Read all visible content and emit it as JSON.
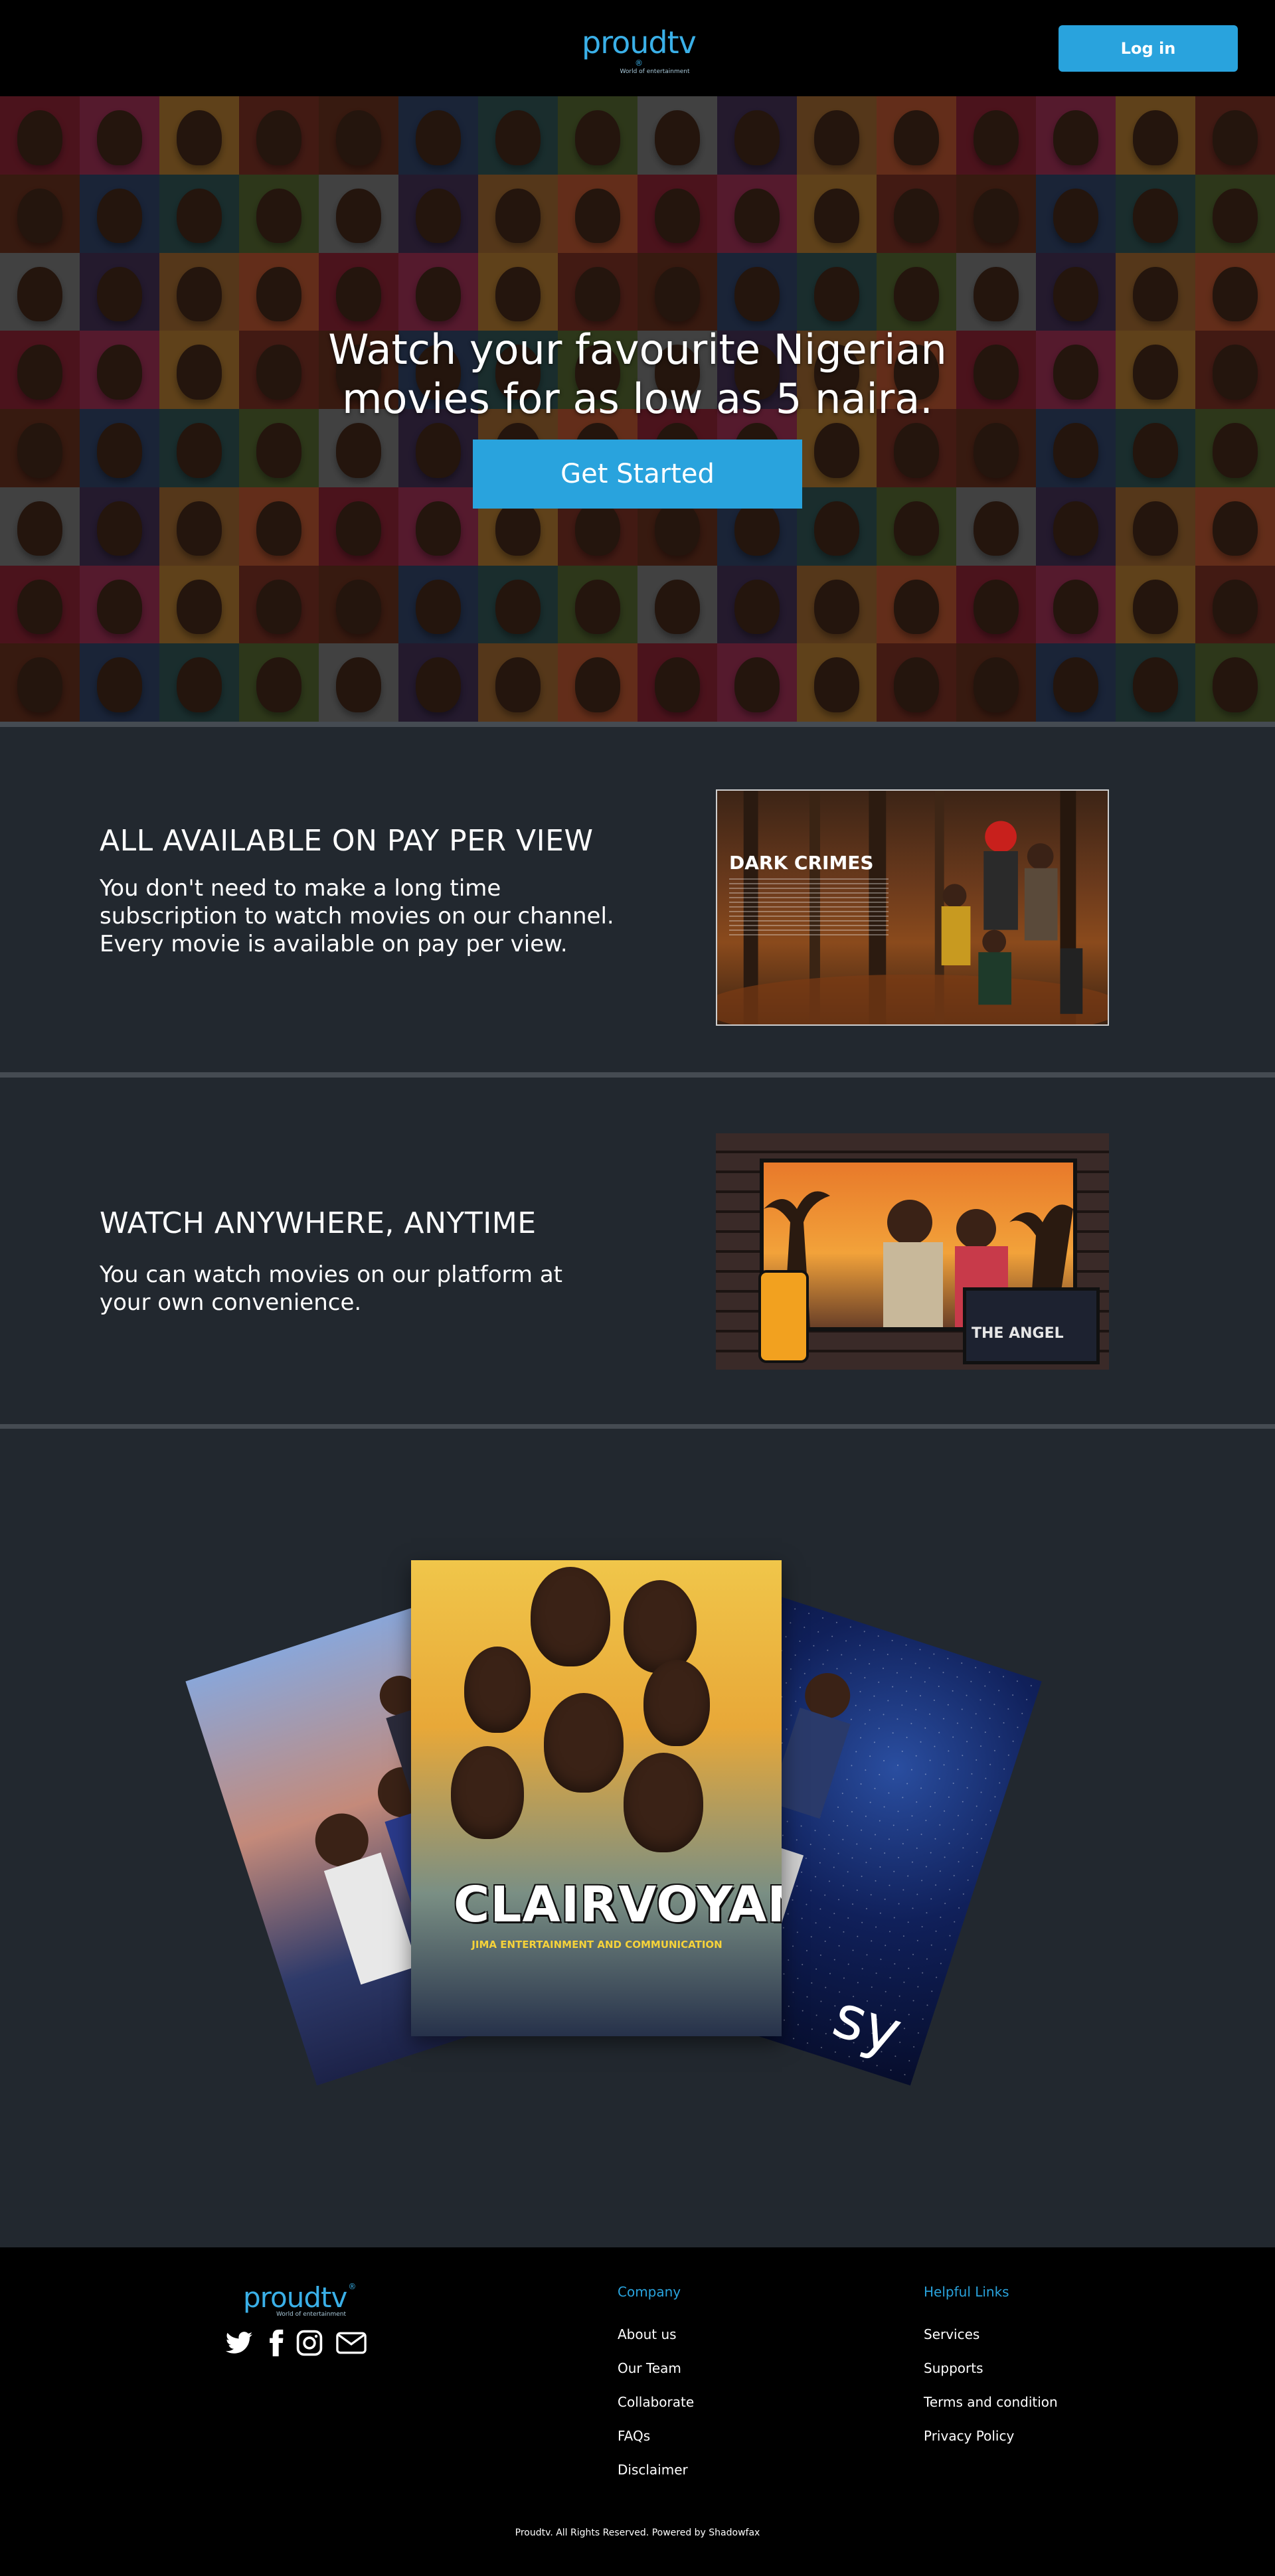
{
  "header": {
    "logo_text": "proudtv",
    "logo_mark": "®",
    "logo_tagline": "World of entertainment",
    "login_label": "Log in",
    "accent_color": "#29a3dd"
  },
  "hero": {
    "headline_line1": "Watch your favourite Nigerian",
    "headline_line2": "movies for as low as 5 naira.",
    "cta_label": "Get Started"
  },
  "features": [
    {
      "title": "ALL AVAILABLE ON PAY PER VIEW",
      "text": "You don't need to make a long time subscription to watch movies on our channel. Every movie is available on pay per view.",
      "poster_title": "DARK CRIMES"
    },
    {
      "title": "WATCH ANYWHERE, ANYTIME",
      "text": "You can watch movies on our platform at your own convenience.",
      "poster_title": "THE ANGEL"
    }
  ],
  "posters": {
    "center_title": "CLAIRVOYANT",
    "center_subtitle": "JIMA ENTERTAINMENT AND COMMUNICATION",
    "right_fragment": "sy"
  },
  "footer": {
    "logo_text": "proudtv",
    "logo_mark": "®",
    "logo_tagline": "World of entertainment",
    "socials": [
      "twitter-icon",
      "facebook-icon",
      "instagram-icon",
      "mail-icon"
    ],
    "company_title": "Company",
    "company_links": [
      "About us",
      "Our Team",
      "Collaborate",
      "FAQs",
      "Disclaimer"
    ],
    "helpful_title": "Helpful Links",
    "helpful_links": [
      "Services",
      "Supports",
      "Terms and condition",
      "Privacy Policy"
    ],
    "copyright": "Proudtv. All Rights Reserved. Powered by Shadowfax"
  }
}
